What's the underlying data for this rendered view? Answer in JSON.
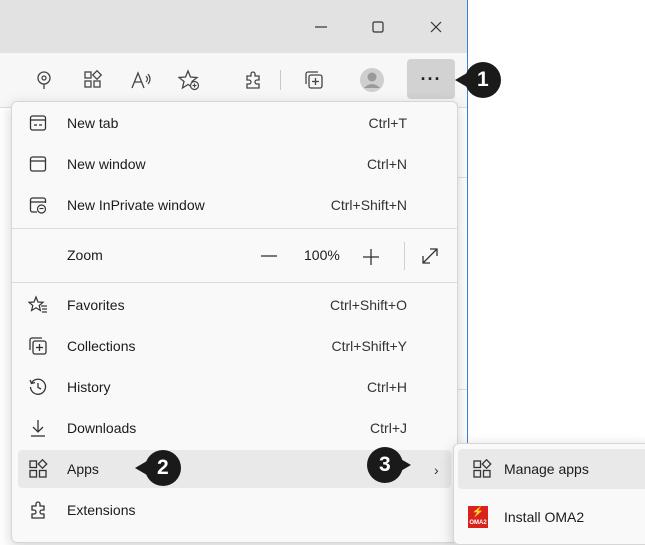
{
  "toolbar": {
    "more_label": "···"
  },
  "menu": {
    "items": [
      {
        "label": "New tab",
        "shortcut": "Ctrl+T"
      },
      {
        "label": "New window",
        "shortcut": "Ctrl+N"
      },
      {
        "label": "New InPrivate window",
        "shortcut": "Ctrl+Shift+N"
      },
      {
        "label": "Favorites",
        "shortcut": "Ctrl+Shift+O"
      },
      {
        "label": "Collections",
        "shortcut": "Ctrl+Shift+Y"
      },
      {
        "label": "History",
        "shortcut": "Ctrl+H"
      },
      {
        "label": "Downloads",
        "shortcut": "Ctrl+J"
      },
      {
        "label": "Apps",
        "shortcut": ""
      },
      {
        "label": "Extensions",
        "shortcut": ""
      }
    ],
    "zoom": {
      "label": "Zoom",
      "value": "100%",
      "minus": "—",
      "plus": "+"
    },
    "apps_chevron": "›"
  },
  "submenu": {
    "items": [
      {
        "label": "Manage apps"
      },
      {
        "label": "Install OMA2"
      }
    ],
    "logo_text": "OMA2"
  },
  "callouts": [
    "1",
    "2",
    "3"
  ],
  "colors": {
    "callout_fill": "#1a1a1a",
    "window_border": "#3c7fd4",
    "logo_red": "#d9221c"
  }
}
